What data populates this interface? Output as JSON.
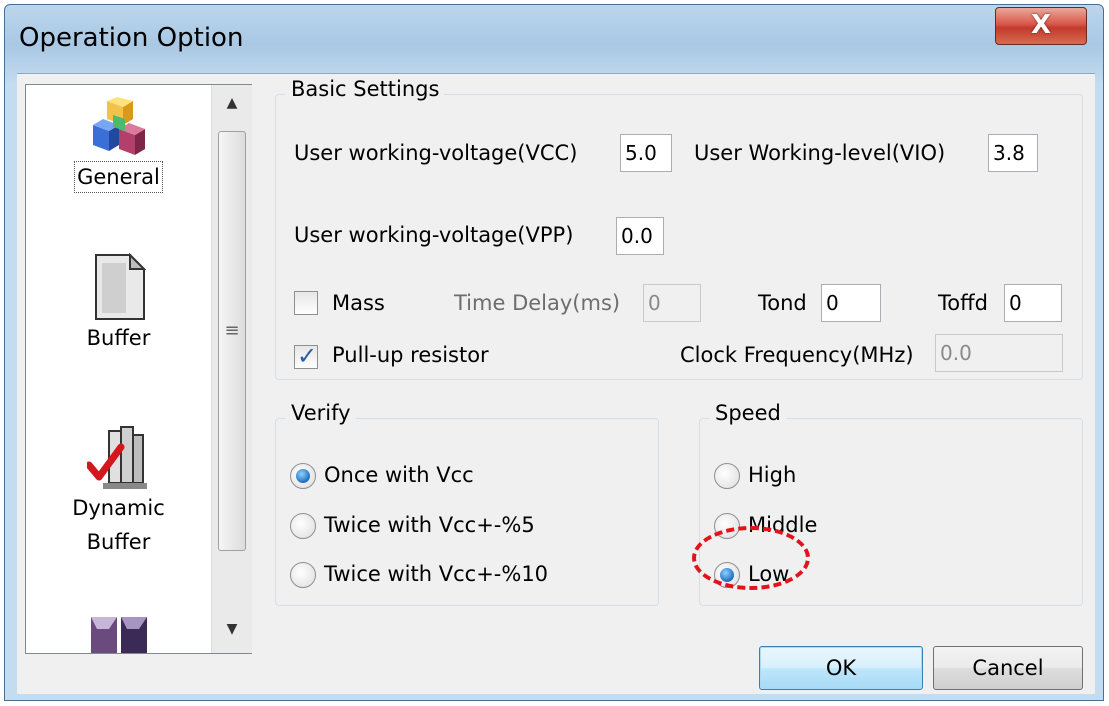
{
  "window": {
    "title": "Operation Option",
    "close_glyph": "X"
  },
  "nav": {
    "items": [
      {
        "label": "General",
        "icon": "cubes-icon",
        "selected": true
      },
      {
        "label": "Buffer",
        "icon": "document-icon",
        "selected": false
      },
      {
        "label": "Dynamic Buffer",
        "icon": "checked-buffer-icon",
        "selected": false
      },
      {
        "label": "",
        "icon": "chip-icon",
        "selected": false
      }
    ],
    "scroll_up": "▲",
    "scroll_down": "▼",
    "scroll_grip": "≡"
  },
  "basic_settings": {
    "legend": "Basic Settings",
    "vcc_label": "User working-voltage(VCC)",
    "vcc_value": "5.0",
    "vio_label": "User Working-level(VIO)",
    "vio_value": "3.8",
    "vpp_label": "User working-voltage(VPP)",
    "vpp_value": "0.0",
    "mass_label": "Mass",
    "mass_checked": false,
    "time_delay_label": "Time Delay(ms)",
    "time_delay_value": "0",
    "tond_label": "Tond",
    "tond_value": "0",
    "toffd_label": "Toffd",
    "toffd_value": "0",
    "pullup_label": "Pull-up resistor",
    "pullup_checked": true,
    "clock_label": "Clock Frequency(MHz)",
    "clock_value": "0.0"
  },
  "verify": {
    "legend": "Verify",
    "options": [
      {
        "label": "Once with Vcc",
        "selected": true
      },
      {
        "label": "Twice with Vcc+-%5",
        "selected": false
      },
      {
        "label": "Twice with Vcc+-%10",
        "selected": false
      }
    ]
  },
  "speed": {
    "legend": "Speed",
    "options": [
      {
        "label": "High",
        "selected": false
      },
      {
        "label": "Middle",
        "selected": false
      },
      {
        "label": "Low",
        "selected": true
      }
    ],
    "highlight_color": "#e3131b"
  },
  "buttons": {
    "ok": "OK",
    "cancel": "Cancel"
  },
  "colors": {
    "accent": "#3c7fb1",
    "radio_fill": "#1f6fbf",
    "check_mark": "#2a5ea8"
  }
}
